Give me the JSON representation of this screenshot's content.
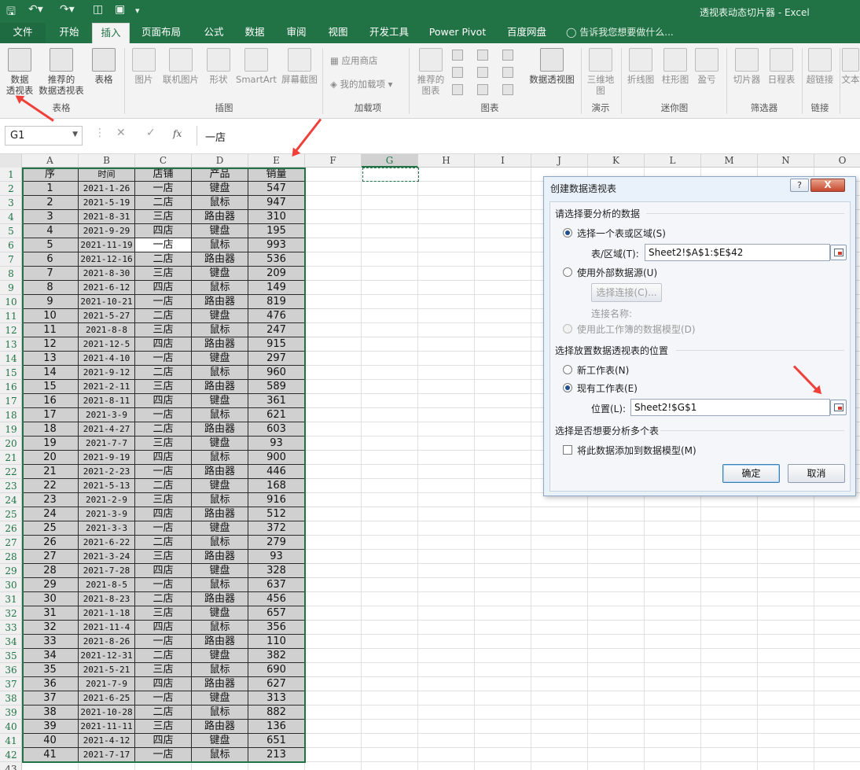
{
  "window": {
    "title": "透视表动态切片器 - Excel"
  },
  "tabs": [
    "文件",
    "开始",
    "插入",
    "页面布局",
    "公式",
    "数据",
    "审阅",
    "视图",
    "开发工具",
    "Power Pivot",
    "百度网盘"
  ],
  "active_tab": "插入",
  "tell_me": "告诉我您想要做什么...",
  "ribbon": {
    "table_group": {
      "label": "表格",
      "pivot": "数据\n透视表",
      "recommended_pivot": "推荐的\n数据透视表",
      "table": "表格"
    },
    "illustrations_group": {
      "label": "插图",
      "picture": "图片",
      "online_picture": "联机图片",
      "shapes": "形状",
      "smartart": "SmartArt",
      "screenshot": "屏幕截图"
    },
    "addins_group": {
      "label": "加载项",
      "store": "应用商店",
      "my_addins": "我的加载项"
    },
    "charts_group": {
      "label": "图表",
      "recommended_charts": "推荐的\n图表",
      "pivot_chart": "数据透视图"
    },
    "tours_group": {
      "label": "演示",
      "map3d": "三维地\n图"
    },
    "sparklines_group": {
      "label": "迷你图",
      "line": "折线图",
      "column": "柱形图",
      "win_loss": "盈亏"
    },
    "filters_group": {
      "label": "筛选器",
      "slicer": "切片器",
      "timeline": "日程表"
    },
    "links_group": {
      "label": "链接",
      "hyperlink": "超链接"
    },
    "text_group": {
      "text": "文本"
    }
  },
  "formula_bar": {
    "name_box": "G1",
    "formula": "一店",
    "fx": "fx"
  },
  "columns": [
    "A",
    "B",
    "C",
    "D",
    "E",
    "F",
    "G",
    "H",
    "I",
    "J",
    "K",
    "L",
    "M",
    "N",
    "O"
  ],
  "selected_column": "G",
  "header": [
    "序",
    "时间",
    "店铺",
    "产品",
    "销量"
  ],
  "rows": [
    [
      1,
      "2021-1-26",
      "一店",
      "键盘",
      547
    ],
    [
      2,
      "2021-5-19",
      "二店",
      "鼠标",
      947
    ],
    [
      3,
      "2021-8-31",
      "三店",
      "路由器",
      310
    ],
    [
      4,
      "2021-9-29",
      "四店",
      "键盘",
      195
    ],
    [
      5,
      "2021-11-19",
      "一店",
      "鼠标",
      993
    ],
    [
      6,
      "2021-12-16",
      "二店",
      "路由器",
      536
    ],
    [
      7,
      "2021-8-30",
      "三店",
      "键盘",
      209
    ],
    [
      8,
      "2021-6-12",
      "四店",
      "鼠标",
      149
    ],
    [
      9,
      "2021-10-21",
      "一店",
      "路由器",
      819
    ],
    [
      10,
      "2021-5-27",
      "二店",
      "键盘",
      476
    ],
    [
      11,
      "2021-8-8",
      "三店",
      "鼠标",
      247
    ],
    [
      12,
      "2021-12-5",
      "四店",
      "路由器",
      915
    ],
    [
      13,
      "2021-4-10",
      "一店",
      "键盘",
      297
    ],
    [
      14,
      "2021-9-12",
      "二店",
      "鼠标",
      960
    ],
    [
      15,
      "2021-2-11",
      "三店",
      "路由器",
      589
    ],
    [
      16,
      "2021-8-11",
      "四店",
      "键盘",
      361
    ],
    [
      17,
      "2021-3-9",
      "一店",
      "鼠标",
      621
    ],
    [
      18,
      "2021-4-27",
      "二店",
      "路由器",
      603
    ],
    [
      19,
      "2021-7-7",
      "三店",
      "键盘",
      93
    ],
    [
      20,
      "2021-9-19",
      "四店",
      "鼠标",
      900
    ],
    [
      21,
      "2021-2-23",
      "一店",
      "路由器",
      446
    ],
    [
      22,
      "2021-5-13",
      "二店",
      "键盘",
      168
    ],
    [
      23,
      "2021-2-9",
      "三店",
      "鼠标",
      916
    ],
    [
      24,
      "2021-3-9",
      "四店",
      "路由器",
      512
    ],
    [
      25,
      "2021-3-3",
      "一店",
      "键盘",
      372
    ],
    [
      26,
      "2021-6-22",
      "二店",
      "鼠标",
      279
    ],
    [
      27,
      "2021-3-24",
      "三店",
      "路由器",
      93
    ],
    [
      28,
      "2021-7-28",
      "四店",
      "键盘",
      328
    ],
    [
      29,
      "2021-8-5",
      "一店",
      "鼠标",
      637
    ],
    [
      30,
      "2021-8-23",
      "二店",
      "路由器",
      456
    ],
    [
      31,
      "2021-1-18",
      "三店",
      "键盘",
      657
    ],
    [
      32,
      "2021-11-4",
      "四店",
      "鼠标",
      356
    ],
    [
      33,
      "2021-8-26",
      "一店",
      "路由器",
      110
    ],
    [
      34,
      "2021-12-31",
      "二店",
      "键盘",
      382
    ],
    [
      35,
      "2021-5-21",
      "三店",
      "鼠标",
      690
    ],
    [
      36,
      "2021-7-9",
      "四店",
      "路由器",
      627
    ],
    [
      37,
      "2021-6-25",
      "一店",
      "键盘",
      313
    ],
    [
      38,
      "2021-10-28",
      "二店",
      "鼠标",
      882
    ],
    [
      39,
      "2021-11-11",
      "三店",
      "路由器",
      136
    ],
    [
      40,
      "2021-4-12",
      "四店",
      "键盘",
      651
    ],
    [
      41,
      "2021-7-17",
      "一店",
      "鼠标",
      213
    ]
  ],
  "row_numbers": [
    1,
    2,
    3,
    4,
    5,
    6,
    7,
    8,
    9,
    10,
    11,
    12,
    13,
    14,
    15,
    16,
    17,
    18,
    19,
    20,
    21,
    22,
    23,
    24,
    25,
    26,
    27,
    28,
    29,
    30,
    31,
    32,
    33,
    34,
    35,
    36,
    37,
    38,
    39,
    40,
    41,
    42,
    43
  ],
  "dialog": {
    "title": "创建数据透视表",
    "help": "?",
    "close": "X",
    "section_data": "请选择要分析的数据",
    "opt_range": "选择一个表或区域(S)",
    "range_label": "表/区域(T):",
    "range_value": "Sheet2!$A$1:$E$42",
    "opt_external": "使用外部数据源(U)",
    "choose_conn": "选择连接(C)...",
    "conn_name": "连接名称:",
    "opt_model": "使用此工作簿的数据模型(D)",
    "section_place": "选择放置数据透视表的位置",
    "opt_new": "新工作表(N)",
    "opt_existing": "现有工作表(E)",
    "loc_label": "位置(L):",
    "loc_value": "Sheet2!$G$1",
    "section_multi": "选择是否想要分析多个表",
    "add_model": "将此数据添加到数据模型(M)",
    "ok": "确定",
    "cancel": "取消"
  },
  "colors": {
    "excel_green": "#217346",
    "arrow_red": "#f0403a",
    "selection_gray": "#d0d0d0"
  }
}
